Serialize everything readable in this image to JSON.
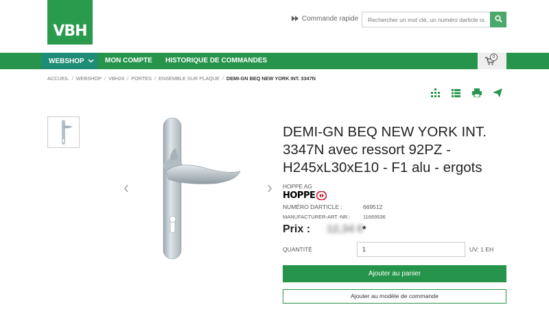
{
  "brand": {
    "logo_text": "VBH",
    "accent_color": "#26944a",
    "teal_color": "#1f8c75"
  },
  "header": {
    "quick_order_label": "Commande rapide",
    "search": {
      "placeholder": "Rechercher un mot clé, un numéro darticle ou catégorie",
      "icon": "search-icon"
    }
  },
  "nav": {
    "items": [
      {
        "label": "WEBSHOP",
        "active": true
      },
      {
        "label": "MON COMPTE"
      },
      {
        "label": "HISTORIQUE DE COMMANDES"
      }
    ],
    "cart_count": "0"
  },
  "breadcrumb": [
    "ACCUEIL",
    "WEBSHOP",
    "VBH24",
    "PORTES",
    "ENSEMBLE SUR PLAQUE",
    "DEMI-GN BEQ NEW YORK INT. 3347N"
  ],
  "actions": [
    "barcode-grid-icon",
    "list-icon",
    "print-icon",
    "send-icon"
  ],
  "product": {
    "title": "DEMI-GN BEQ NEW YORK INT. 3347N avec ressort 92PZ - H245xL30xE10 - F1 alu - ergots",
    "brand_name": "HOPPE AG",
    "brand_logo_text": "HOPPE",
    "article_label": "NUMÉRO DARTICLE :",
    "article_value": "669512",
    "manufacturer_label": "MANUFACTURER-ART.-NR.:",
    "manufacturer_value": "11669536",
    "price_label": "Prix :",
    "price_value": "12,34 €",
    "price_note": "*",
    "quantity_label": "QUANTITÉ",
    "quantity_value": "1",
    "unit_label": "UV: 1 EH",
    "add_to_cart": "Ajouter au panier",
    "add_to_model": "Ajouter au modèle de commande"
  }
}
